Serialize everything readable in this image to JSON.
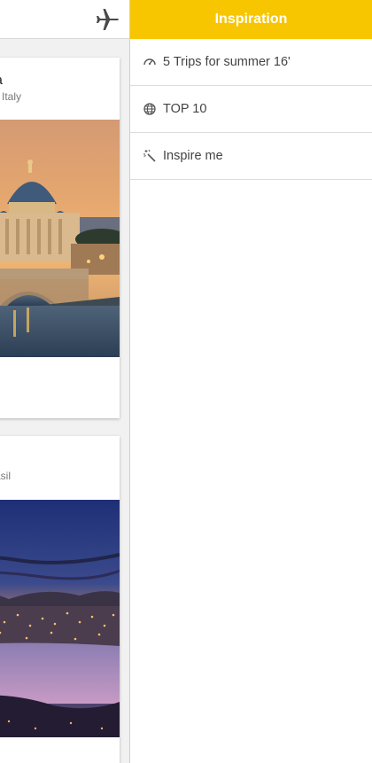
{
  "header": {
    "plane_icon": "airplane-icon"
  },
  "cards": [
    {
      "title": "ma",
      "subtitle": "na, Italy",
      "image": "rome-vatican-dusk-photo"
    },
    {
      "title": "",
      "subtitle": "Brasil",
      "image": "rio-de-janeiro-night-photo"
    }
  ],
  "drawer": {
    "title": "Inspiration",
    "accent_color": "#f7c600",
    "items": [
      {
        "label": "5 Trips for summer 16'",
        "icon": "gauge-icon"
      },
      {
        "label": "TOP 10",
        "icon": "globe-icon"
      },
      {
        "label": "Inspire me",
        "icon": "magic-wand-icon"
      }
    ]
  }
}
